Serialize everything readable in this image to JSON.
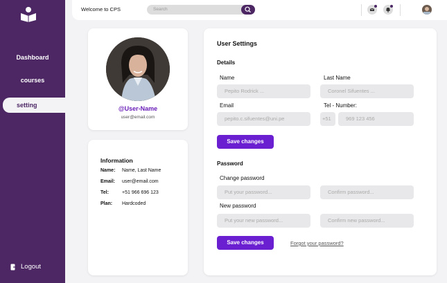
{
  "sidebar": {
    "items": [
      {
        "label": "Dashboard"
      },
      {
        "label": "courses"
      },
      {
        "label": "setting"
      }
    ],
    "logout_label": "Logout"
  },
  "topbar": {
    "welcome": "Welcome to CPS",
    "search_placeholder": "Search"
  },
  "profile": {
    "username": "@User-Name",
    "email": "user@email.com"
  },
  "info": {
    "title": "Information",
    "rows": [
      {
        "label": "Name:",
        "value": "Name, Last Name"
      },
      {
        "label": "Email:",
        "value": "user@email.com"
      },
      {
        "label": "Tel:",
        "value": "+51 966 696 123"
      },
      {
        "label": "Plan:",
        "value": "Hardcoded"
      }
    ]
  },
  "settings": {
    "title": "User Settings",
    "details": {
      "heading": "Details",
      "name_label": "Name",
      "name_placeholder": "Pepito Rodrick ...",
      "lastname_label": "Last Name",
      "lastname_placeholder": "Coronel Sifuentes ...",
      "email_label": "Email",
      "email_placeholder": "pepito.c.sifuentes@uni.pe",
      "tel_label": "Tel - Number:",
      "tel_prefix": "+51",
      "tel_placeholder": "969 123 456",
      "save_label": "Save changes"
    },
    "password": {
      "heading": "Password",
      "change_label": "Change password",
      "current_placeholder": "Put your password...",
      "confirm_placeholder": "Confirm password...",
      "new_label": "New password",
      "new_placeholder": "Put your new password...",
      "confirm_new_placeholder": "Confirm new password...",
      "save_label": "Save changes",
      "forgot_label": "Forgot your password?"
    }
  }
}
